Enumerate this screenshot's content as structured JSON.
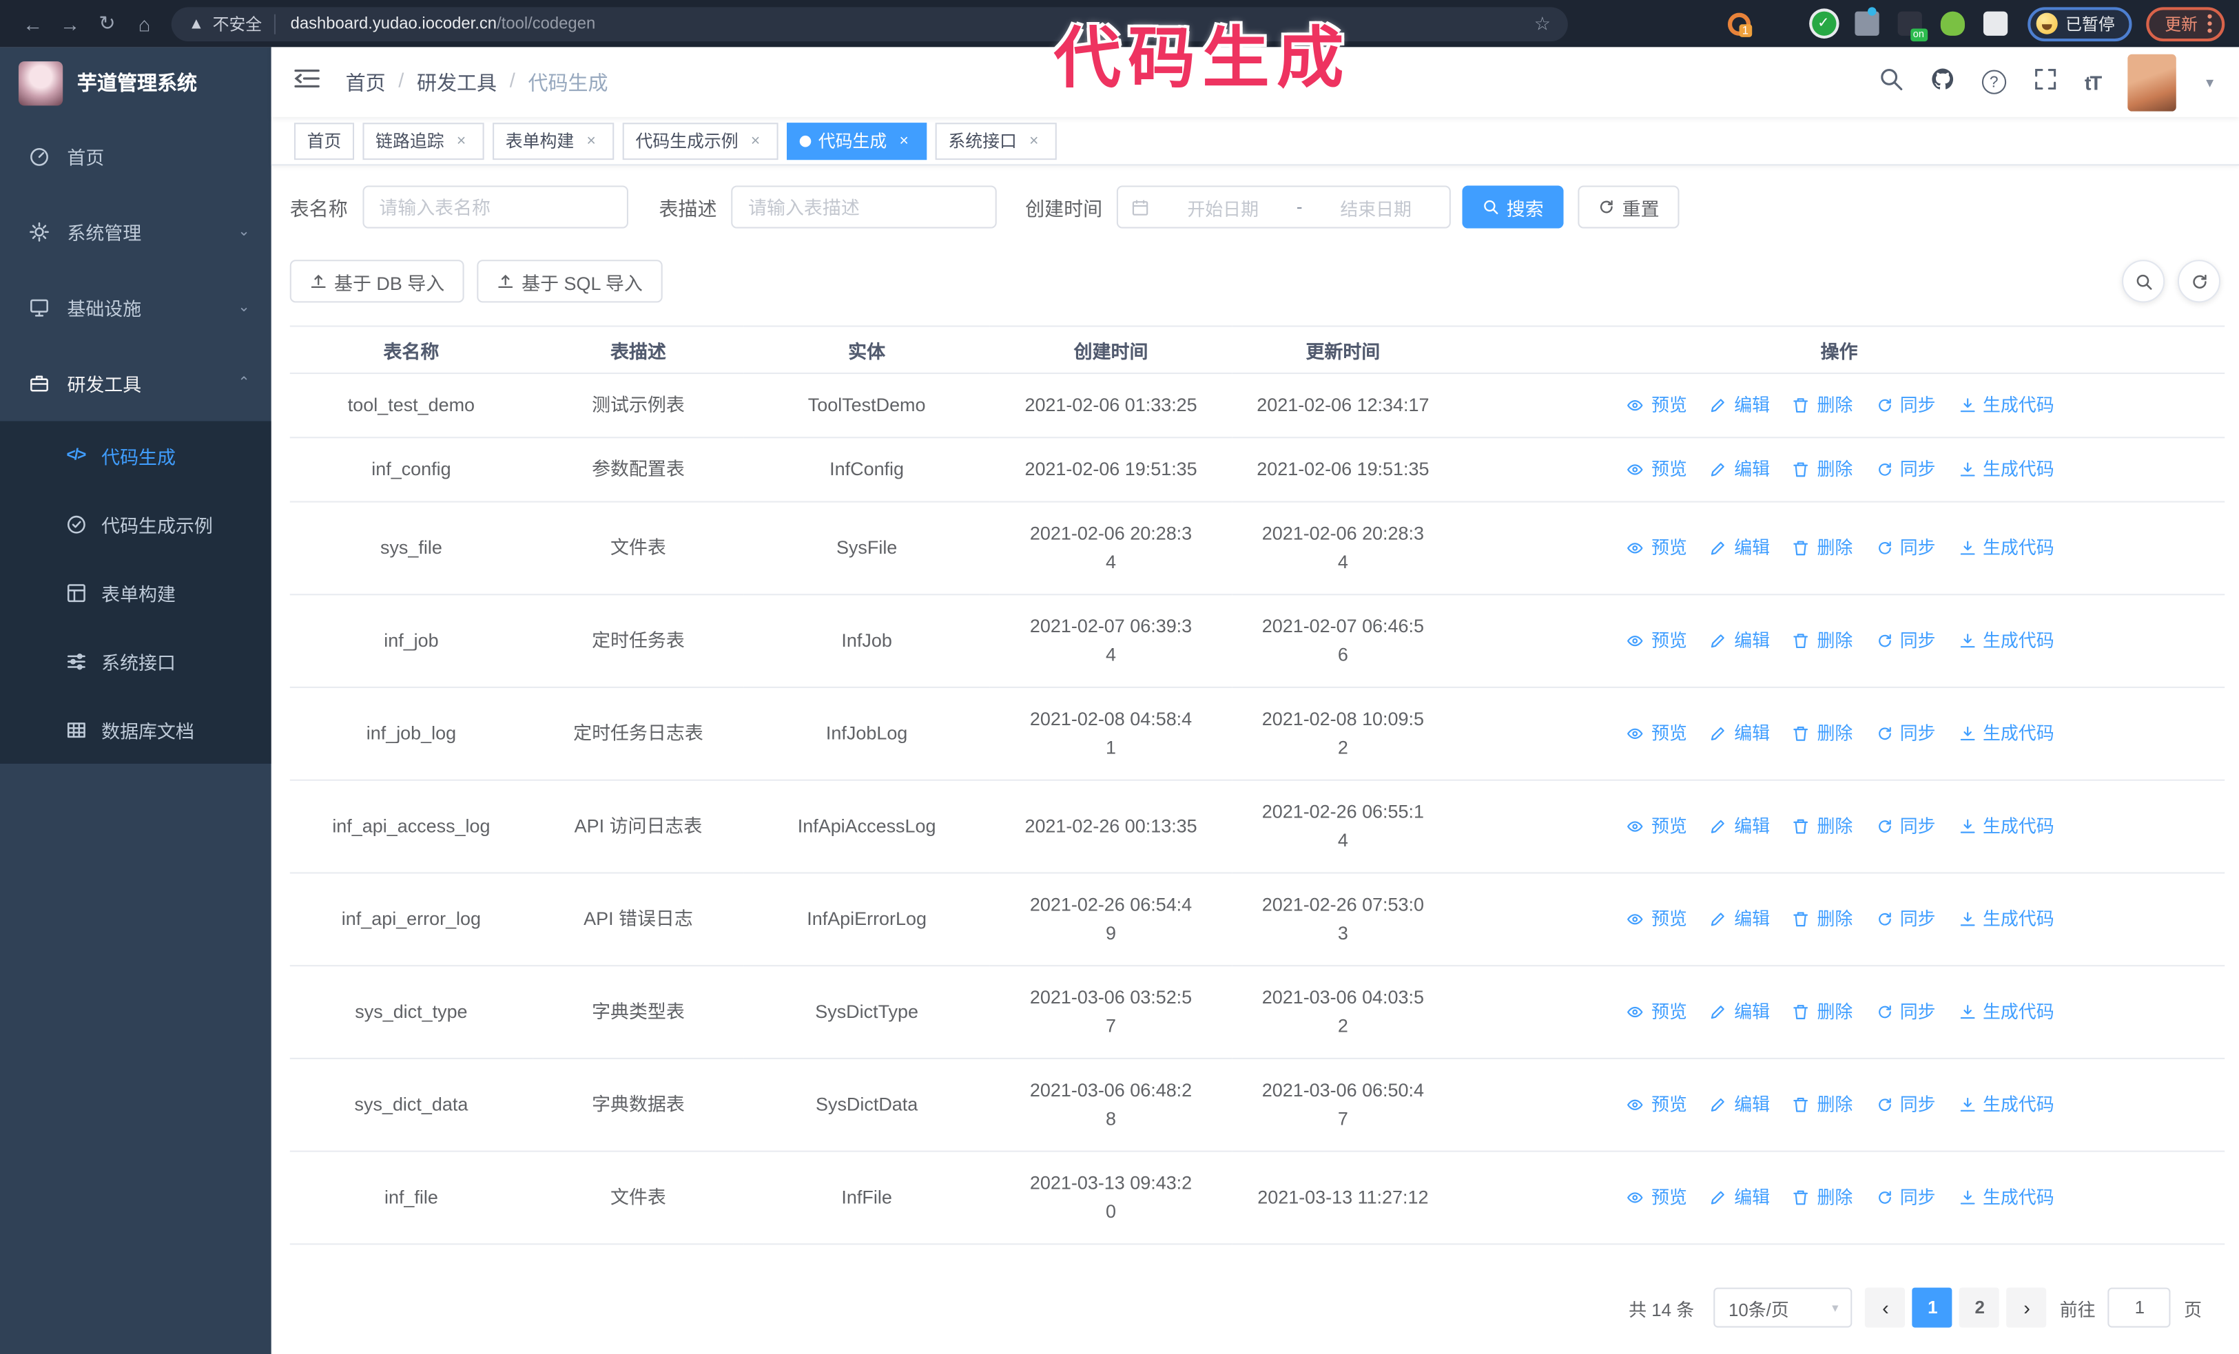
{
  "annotation": {
    "text": "代码生成",
    "color": "#ee3360"
  },
  "browser": {
    "security_label": "不安全",
    "url_host": "dashboard.yudao.iocoder.cn",
    "url_path": "/tool/codegen",
    "extension_badge": "1",
    "extension_on_badge": "on",
    "paused_button": "已暂停",
    "update_button": "更新"
  },
  "sidebar": {
    "app_title": "芋道管理系统",
    "menu": [
      {
        "label": "首页",
        "icon": "dashboard-icon",
        "chevron": null,
        "open": false
      },
      {
        "label": "系统管理",
        "icon": "gear-icon",
        "chevron": "down",
        "open": false
      },
      {
        "label": "基础设施",
        "icon": "infra-icon",
        "chevron": "down",
        "open": false
      },
      {
        "label": "研发工具",
        "icon": "tools-icon",
        "chevron": "up",
        "open": true
      }
    ],
    "submenu": [
      {
        "label": "代码生成",
        "icon": "code-icon",
        "active": true
      },
      {
        "label": "代码生成示例",
        "icon": "example-icon",
        "active": false
      },
      {
        "label": "表单构建",
        "icon": "form-icon",
        "active": false
      },
      {
        "label": "系统接口",
        "icon": "api-icon",
        "active": false
      },
      {
        "label": "数据库文档",
        "icon": "database-icon",
        "active": false
      }
    ]
  },
  "topbar": {
    "breadcrumb": [
      "首页",
      "研发工具",
      "代码生成"
    ],
    "separator": "/"
  },
  "tabs": [
    {
      "label": "首页",
      "closable": false,
      "active": false
    },
    {
      "label": "链路追踪",
      "closable": true,
      "active": false
    },
    {
      "label": "表单构建",
      "closable": true,
      "active": false
    },
    {
      "label": "代码生成示例",
      "closable": true,
      "active": false
    },
    {
      "label": "代码生成",
      "closable": true,
      "active": true
    },
    {
      "label": "系统接口",
      "closable": true,
      "active": false
    }
  ],
  "filters": {
    "table_name_label": "表名称",
    "table_name_placeholder": "请输入表名称",
    "table_desc_label": "表描述",
    "table_desc_placeholder": "请输入表描述",
    "create_time_label": "创建时间",
    "date_start_placeholder": "开始日期",
    "date_separator": "-",
    "date_end_placeholder": "结束日期",
    "search_button": "搜索",
    "reset_button": "重置"
  },
  "toolbar": {
    "db_import_button": "基于 DB 导入",
    "sql_import_button": "基于 SQL 导入"
  },
  "table": {
    "columns": [
      "表名称",
      "表描述",
      "实体",
      "创建时间",
      "更新时间",
      "操作"
    ],
    "actions": [
      {
        "label": "预览",
        "icon": "eye-icon"
      },
      {
        "label": "编辑",
        "icon": "edit-icon"
      },
      {
        "label": "删除",
        "icon": "delete-icon"
      },
      {
        "label": "同步",
        "icon": "sync-icon"
      },
      {
        "label": "生成代码",
        "icon": "download-icon"
      }
    ],
    "rows": [
      {
        "name": "tool_test_demo",
        "desc": "测试示例表",
        "entity": "ToolTestDemo",
        "created": "2021-02-06 01:33:25",
        "updated": "2021-02-06 12:34:17"
      },
      {
        "name": "inf_config",
        "desc": "参数配置表",
        "entity": "InfConfig",
        "created": "2021-02-06 19:51:35",
        "updated": "2021-02-06 19:51:35"
      },
      {
        "name": "sys_file",
        "desc": "文件表",
        "entity": "SysFile",
        "created": "2021-02-06 20:28:3\n4",
        "updated": "2021-02-06 20:28:3\n4"
      },
      {
        "name": "inf_job",
        "desc": "定时任务表",
        "entity": "InfJob",
        "created": "2021-02-07 06:39:3\n4",
        "updated": "2021-02-07 06:46:5\n6"
      },
      {
        "name": "inf_job_log",
        "desc": "定时任务日志表",
        "entity": "InfJobLog",
        "created": "2021-02-08 04:58:4\n1",
        "updated": "2021-02-08 10:09:5\n2"
      },
      {
        "name": "inf_api_access_log",
        "desc": "API 访问日志表",
        "entity": "InfApiAccessLog",
        "created": "2021-02-26 00:13:35",
        "updated": "2021-02-26 06:55:1\n4"
      },
      {
        "name": "inf_api_error_log",
        "desc": "API 错误日志",
        "entity": "InfApiErrorLog",
        "created": "2021-02-26 06:54:4\n9",
        "updated": "2021-02-26 07:53:0\n3"
      },
      {
        "name": "sys_dict_type",
        "desc": "字典类型表",
        "entity": "SysDictType",
        "created": "2021-03-06 03:52:5\n7",
        "updated": "2021-03-06 04:03:5\n2"
      },
      {
        "name": "sys_dict_data",
        "desc": "字典数据表",
        "entity": "SysDictData",
        "created": "2021-03-06 06:48:2\n8",
        "updated": "2021-03-06 06:50:4\n7"
      },
      {
        "name": "inf_file",
        "desc": "文件表",
        "entity": "InfFile",
        "created": "2021-03-13 09:43:2\n0",
        "updated": "2021-03-13 11:27:12"
      }
    ]
  },
  "pagination": {
    "total": "共 14 条",
    "page_size": "10条/页",
    "pages": [
      "1",
      "2"
    ],
    "active_page": "1",
    "goto_label": "前往",
    "goto_value": "1",
    "page_unit": "页"
  },
  "colors": {
    "primary": "#409EFF",
    "sidebar_bg": "#304156",
    "submenu_bg": "#1f2d3d"
  }
}
